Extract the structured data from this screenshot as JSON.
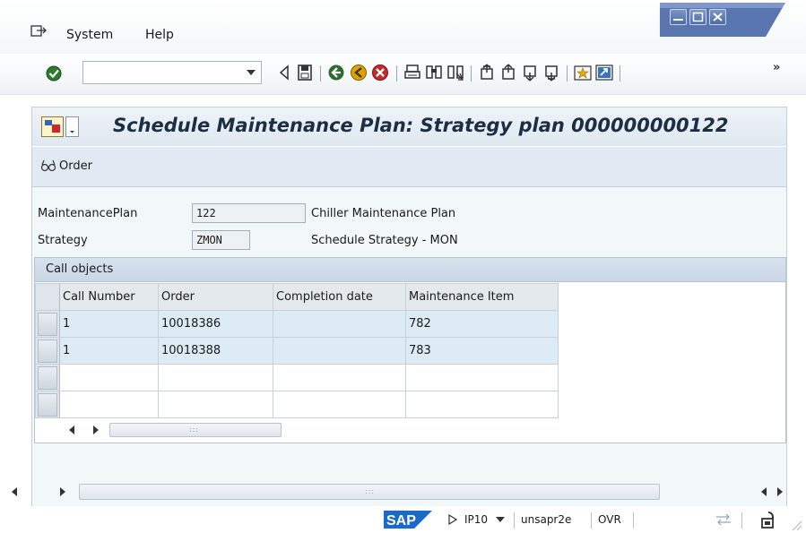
{
  "menubar": {
    "items": [
      {
        "label": "System"
      },
      {
        "label": "Help"
      }
    ]
  },
  "title": {
    "text": "Schedule Maintenance Plan: Strategy plan 000000000122"
  },
  "application_toolbar": {
    "order_label": "Order"
  },
  "form": {
    "maintenance_plan": {
      "label": "MaintenancePlan",
      "value": "122",
      "description": "Chiller Maintenance Plan"
    },
    "strategy": {
      "label": "Strategy",
      "value": "ZMON",
      "description": "Schedule Strategy - MON"
    }
  },
  "call_objects": {
    "caption": "Call objects",
    "columns": [
      "Call Number",
      "Order",
      "Completion date",
      "Maintenance Item"
    ],
    "rows": [
      {
        "call_number": "1",
        "order": "10018386",
        "completion_date": "",
        "maintenance_item": "782"
      },
      {
        "call_number": "1",
        "order": "10018388",
        "completion_date": "",
        "maintenance_item": "783"
      }
    ]
  },
  "statusbar": {
    "logo_text": "SAP",
    "system": "IP10",
    "server": "unsapr2e",
    "mode": "OVR"
  },
  "colors": {
    "sap_blue": "#1b6ac9",
    "title_text": "#1d2d44",
    "header_bg": "#dfe8f1",
    "row_selected_bg": "#ddebf5",
    "window_controls": "#4e6aa6"
  },
  "icons": {
    "menubar": [
      "exit-menu-icon"
    ],
    "toolbar": [
      "enter-check-icon",
      "back-arrow-icon",
      "save-icon",
      "back-icon",
      "exit-icon",
      "cancel-icon",
      "print-icon",
      "find-icon",
      "find-next-icon",
      "first-page-icon",
      "previous-page-icon",
      "next-page-icon",
      "last-page-icon",
      "create-session-icon",
      "shortcut-icon"
    ],
    "statusbar": [
      "play-icon",
      "dropdown-icon",
      "sync-icon",
      "lock-icon"
    ]
  }
}
